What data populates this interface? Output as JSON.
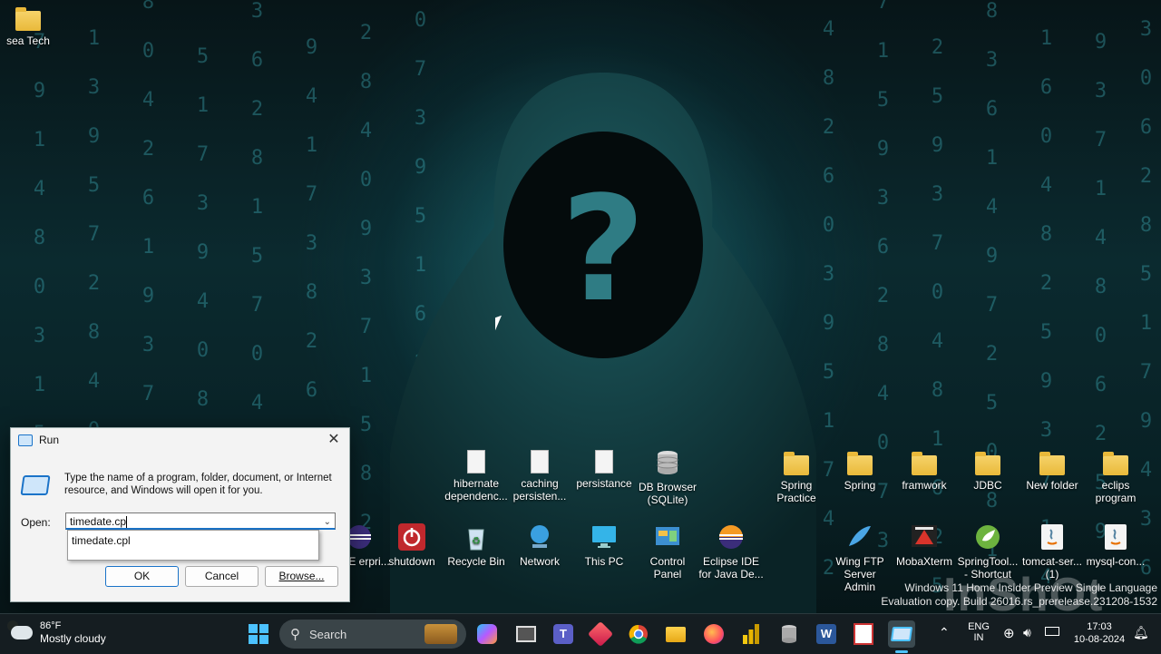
{
  "desktop": {
    "top_icon": {
      "label": "sea Tech",
      "icon": "folder-icon"
    },
    "row1": [
      {
        "label": "hibernate dependenc...",
        "icon": "document-icon"
      },
      {
        "label": "caching persisten...",
        "icon": "document-icon"
      },
      {
        "label": "persistance",
        "icon": "document-icon"
      },
      {
        "label": "DB Browser (SQLite)",
        "icon": "database-icon"
      },
      {
        "label": "Spring Practice",
        "icon": "folder-icon"
      },
      {
        "label": "Spring",
        "icon": "folder-icon"
      },
      {
        "label": "framwork",
        "icon": "folder-icon"
      },
      {
        "label": "JDBC",
        "icon": "folder-icon"
      },
      {
        "label": "New folder",
        "icon": "folder-icon"
      },
      {
        "label": "eclips program",
        "icon": "folder-icon"
      }
    ],
    "row2": [
      {
        "label": "e IDE erpri...",
        "icon": "eclipse-icon"
      },
      {
        "label": "shutdown",
        "icon": "power-icon"
      },
      {
        "label": "Recycle Bin",
        "icon": "recycle-bin-icon"
      },
      {
        "label": "Network",
        "icon": "network-icon"
      },
      {
        "label": "This PC",
        "icon": "monitor-icon"
      },
      {
        "label": "Control Panel",
        "icon": "control-panel-icon"
      },
      {
        "label": "Eclipse IDE for Java De...",
        "icon": "eclipse-icon"
      },
      {
        "label": "Wing FTP Server Admin",
        "icon": "wing-ftp-icon"
      },
      {
        "label": "MobaXterm",
        "icon": "mobaxterm-icon"
      },
      {
        "label": "SpringTool... - Shortcut",
        "icon": "spring-tool-icon"
      },
      {
        "label": "tomcat-ser... (1)",
        "icon": "java-icon"
      },
      {
        "label": "mysql-con...",
        "icon": "java-icon"
      }
    ]
  },
  "run_dialog": {
    "title": "Run",
    "description": "Type the name of a program, folder, document, or Internet resource, and Windows will open it for you.",
    "open_label": "Open:",
    "input_value": "timedate.cp",
    "suggestion": "timedate.cpl",
    "ok_label": "OK",
    "cancel_label": "Cancel",
    "browse_label": "Browse..."
  },
  "watermark": {
    "line1": "Windows 11 Home Insider Preview Single Language",
    "line2": "Evaluation copy. Build 26016.rs_prerelease.231208-1532",
    "brand": "InShOt"
  },
  "taskbar": {
    "weather_temp": "86°F",
    "weather_desc": "Mostly cloudy",
    "search_label": "Search",
    "lang_top": "ENG",
    "lang_bottom": "IN",
    "time": "17:03",
    "date": "10-08-2024"
  }
}
